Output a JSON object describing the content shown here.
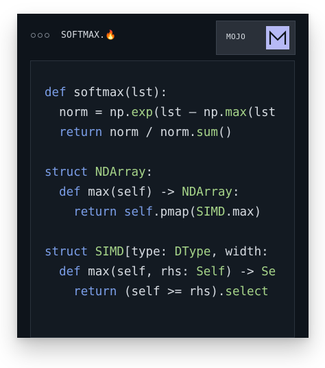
{
  "window": {
    "filename": "SOFTMAX.🔥",
    "language_label": "MOJO",
    "language_icon": "M"
  },
  "code_lines": [
    [
      {
        "t": "def",
        "c": "keyword"
      },
      {
        "t": " softmax(lst):",
        "c": "name"
      }
    ],
    [
      {
        "t": "  norm = np.",
        "c": "name"
      },
      {
        "t": "exp",
        "c": "builtin"
      },
      {
        "t": "(lst – np.",
        "c": "name"
      },
      {
        "t": "max",
        "c": "builtin"
      },
      {
        "t": "(lst",
        "c": "name"
      }
    ],
    [
      {
        "t": "  ",
        "c": "name"
      },
      {
        "t": "return",
        "c": "keyword"
      },
      {
        "t": " norm / norm.",
        "c": "name"
      },
      {
        "t": "sum",
        "c": "builtin"
      },
      {
        "t": "()",
        "c": "name"
      }
    ],
    [],
    [
      {
        "t": "struct",
        "c": "keyword"
      },
      {
        "t": " ",
        "c": "name"
      },
      {
        "t": "NDArray",
        "c": "type"
      },
      {
        "t": ":",
        "c": "name"
      }
    ],
    [
      {
        "t": "  ",
        "c": "name"
      },
      {
        "t": "def",
        "c": "keyword"
      },
      {
        "t": " max(self) -> ",
        "c": "name"
      },
      {
        "t": "NDArray",
        "c": "type"
      },
      {
        "t": ":",
        "c": "name"
      }
    ],
    [
      {
        "t": "    ",
        "c": "name"
      },
      {
        "t": "return",
        "c": "keyword"
      },
      {
        "t": " ",
        "c": "name"
      },
      {
        "t": "self",
        "c": "keyword"
      },
      {
        "t": ".pmap(",
        "c": "name"
      },
      {
        "t": "SIMD",
        "c": "type"
      },
      {
        "t": ".max)",
        "c": "name"
      }
    ],
    [],
    [
      {
        "t": "struct",
        "c": "keyword"
      },
      {
        "t": " ",
        "c": "name"
      },
      {
        "t": "SIMD",
        "c": "type"
      },
      {
        "t": "[type: ",
        "c": "name"
      },
      {
        "t": "DType",
        "c": "type"
      },
      {
        "t": ", width: ",
        "c": "name"
      }
    ],
    [
      {
        "t": "  ",
        "c": "name"
      },
      {
        "t": "def",
        "c": "keyword"
      },
      {
        "t": " max(self, rhs: ",
        "c": "name"
      },
      {
        "t": "Self",
        "c": "type"
      },
      {
        "t": ") -> ",
        "c": "name"
      },
      {
        "t": "Se",
        "c": "type"
      }
    ],
    [
      {
        "t": "    ",
        "c": "name"
      },
      {
        "t": "return",
        "c": "keyword"
      },
      {
        "t": " (self >= rhs).",
        "c": "name"
      },
      {
        "t": "select",
        "c": "builtin"
      }
    ]
  ]
}
